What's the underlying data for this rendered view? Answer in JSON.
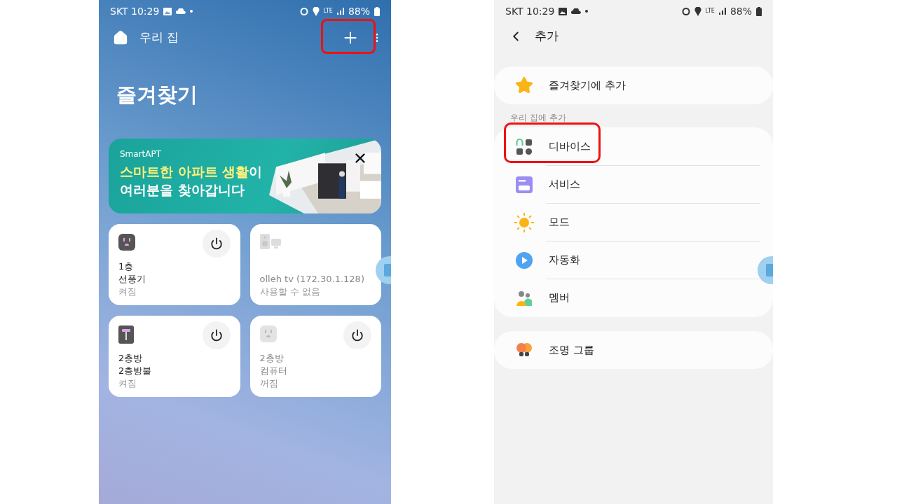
{
  "left_screen": {
    "status_bar": {
      "carrier_time": "SKT 10:29",
      "network": "LTE",
      "battery": "88%"
    },
    "header": {
      "title": "우리 집",
      "add_highlighted": true
    },
    "section_title": "즐겨찾기",
    "banner": {
      "brand": "SmartAPT",
      "headline_accent": "스마트한 아파트 생활",
      "headline_rest": "이",
      "headline_line2": "여러분을 찾아갑니다"
    },
    "devices": [
      {
        "kind": "plug",
        "room": "1층",
        "name": "선풍기",
        "status": "켜짐",
        "active": true,
        "has_power": true
      },
      {
        "kind": "tv",
        "name": "olleh tv (172.30.1.128)",
        "status": "사용할 수 없음",
        "active": false,
        "has_power": false
      },
      {
        "kind": "lamp",
        "room": "2층방",
        "name": "2층방불",
        "status": "켜짐",
        "active": true,
        "has_power": true
      },
      {
        "kind": "plug",
        "room": "2층방",
        "name": "컴퓨터",
        "status": "꺼짐",
        "active": false,
        "has_power": true
      }
    ]
  },
  "right_screen": {
    "status_bar": {
      "carrier_time": "SKT 10:29",
      "network": "LTE",
      "battery": "88%"
    },
    "header": {
      "title": "추가"
    },
    "favorite": {
      "kind": "star",
      "label": "즐겨찾기에 추가"
    },
    "section_label": "우리 집에 추가",
    "items": [
      {
        "kind": "device",
        "label": "디바이스",
        "highlighted": true
      },
      {
        "kind": "service",
        "label": "서비스",
        "highlighted": false
      },
      {
        "kind": "mode",
        "label": "모드",
        "highlighted": false
      },
      {
        "kind": "automation",
        "label": "자동화",
        "highlighted": false
      },
      {
        "kind": "member",
        "label": "멤버",
        "highlighted": false
      }
    ],
    "extra": {
      "kind": "lights",
      "label": "조명 그룹"
    }
  }
}
